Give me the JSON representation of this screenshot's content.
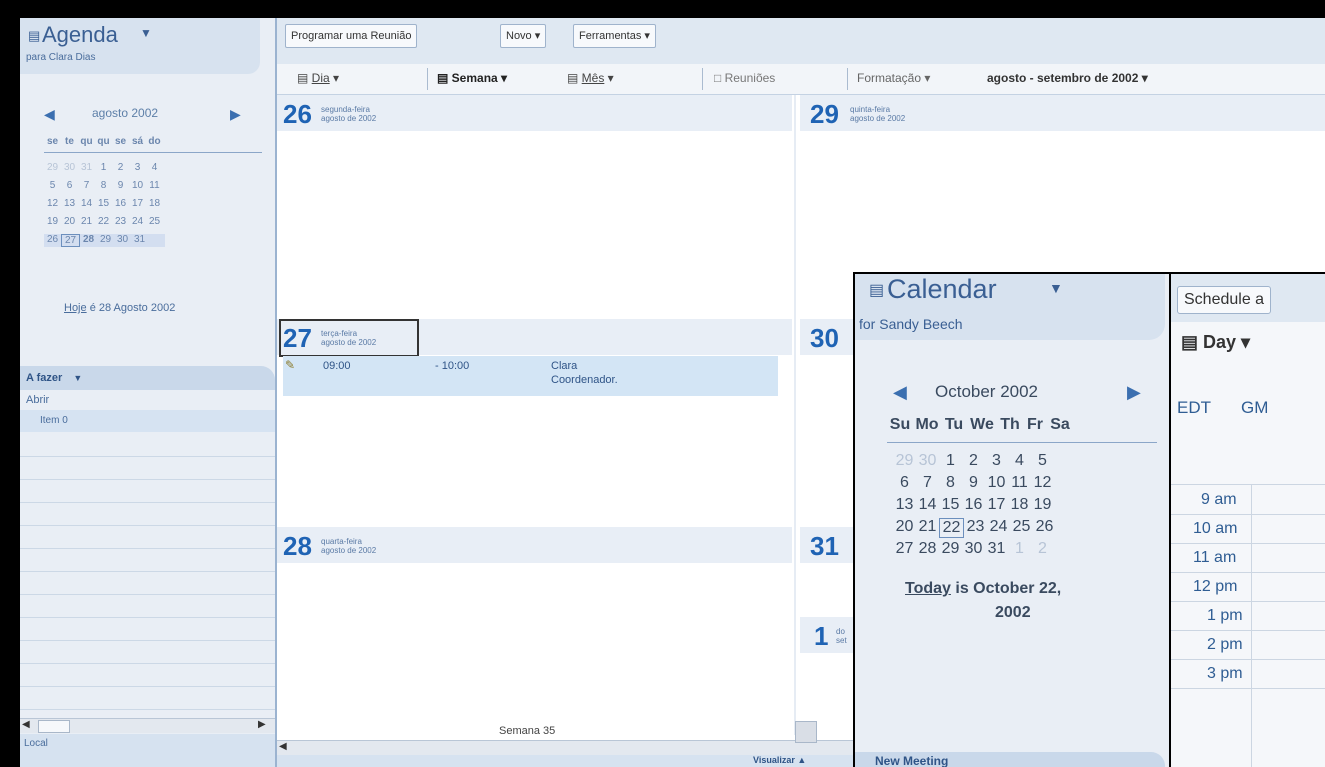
{
  "back": {
    "sidebar": {
      "title": "Agenda",
      "subtitle": "para Clara Dias",
      "month_label": "agosto 2002",
      "weekdays": [
        "se",
        "te",
        "qu",
        "qu",
        "se",
        "sá",
        "do"
      ],
      "weeks": [
        [
          "29",
          "30",
          "31",
          "1",
          "2",
          "3",
          "4"
        ],
        [
          "5",
          "6",
          "7",
          "8",
          "9",
          "10",
          "11"
        ],
        [
          "12",
          "13",
          "14",
          "15",
          "16",
          "17",
          "18"
        ],
        [
          "19",
          "20",
          "21",
          "22",
          "23",
          "24",
          "25"
        ],
        [
          "26",
          "27",
          "28",
          "29",
          "30",
          "31",
          ""
        ]
      ],
      "today_link": "Hoje",
      "today_text": "é 28 Agosto 2002",
      "todo_header": "A fazer",
      "todo_open": "Abrir",
      "todo_item": "Item",
      "todo_item_count": "0",
      "footer": "Local"
    },
    "toolbar": {
      "schedule": "Programar uma Reunião",
      "new": "Novo",
      "tools": "Ferramentas"
    },
    "viewbar": {
      "day": "Dia",
      "week": "Semana",
      "month": "Mês",
      "meetings": "Reuniões",
      "format": "Formatação",
      "range": "agosto - setembro de 2002"
    },
    "days": [
      {
        "num": "26",
        "weekday": "segunda-feira",
        "month": "agosto de 2002"
      },
      {
        "num": "27",
        "weekday": "terça-feira",
        "month": "agosto de 2002"
      },
      {
        "num": "28",
        "weekday": "quarta-feira",
        "month": "agosto de 2002"
      },
      {
        "num": "29",
        "weekday": "quinta-feira",
        "month": "agosto de 2002"
      },
      {
        "num": "30"
      },
      {
        "num": "31"
      },
      {
        "num": "1",
        "weekday": "do",
        "month": "set"
      }
    ],
    "event": {
      "start": "09:00",
      "end": "- 10:00",
      "title": "Clara",
      "title2": "Coordenador."
    },
    "week_label": "Semana 35",
    "bottom_link": "Visualizar"
  },
  "front": {
    "title": "Calendar",
    "subtitle": "for Sandy Beech",
    "schedule_btn": "Schedule a",
    "view_day": "Day",
    "month_label": "October 2002",
    "weekdays": [
      "Su",
      "Mo",
      "Tu",
      "We",
      "Th",
      "Fr",
      "Sa"
    ],
    "weeks": [
      [
        "29",
        "30",
        "1",
        "2",
        "3",
        "4",
        "5"
      ],
      [
        "6",
        "7",
        "8",
        "9",
        "10",
        "11",
        "12"
      ],
      [
        "13",
        "14",
        "15",
        "16",
        "17",
        "18",
        "19"
      ],
      [
        "20",
        "21",
        "22",
        "23",
        "24",
        "25",
        "26"
      ],
      [
        "27",
        "28",
        "29",
        "30",
        "31",
        "1",
        "2"
      ]
    ],
    "today_link": "Today",
    "today_text": "is October 22,",
    "today_year": "2002",
    "tz1": "EDT",
    "tz2": "GM",
    "times": [
      "9 am",
      "10 am",
      "11 am",
      "12 pm",
      "1 pm",
      "2 pm",
      "3 pm"
    ],
    "bottom_label": "New Meeting"
  }
}
